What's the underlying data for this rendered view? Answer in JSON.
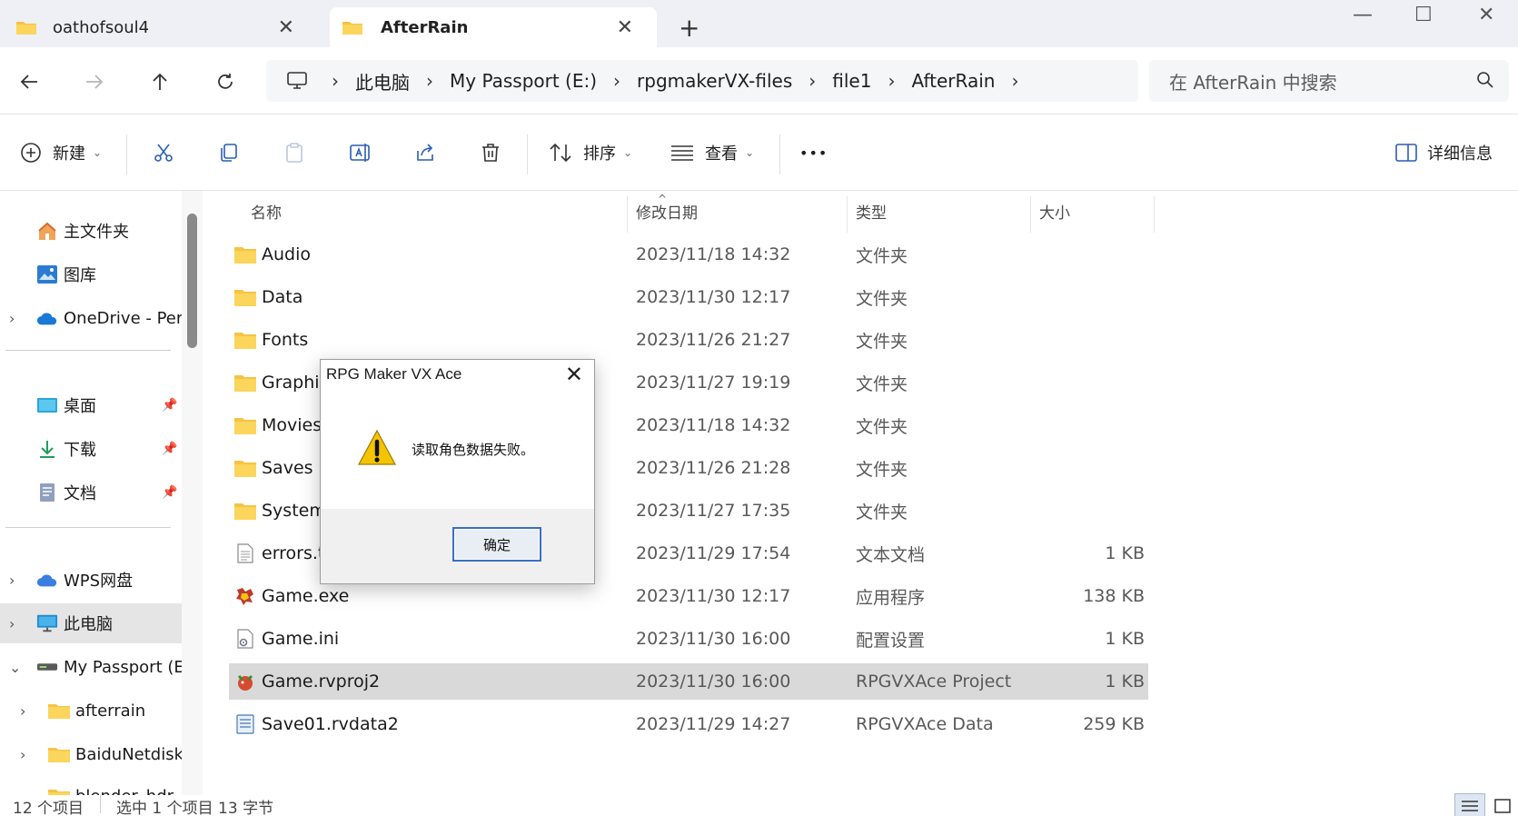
{
  "tabs": [
    {
      "label": "oathofsoul4",
      "active": false
    },
    {
      "label": "AfterRain",
      "active": true
    }
  ],
  "new_tab_symbol": "+",
  "window_controls": {
    "minimize": "—",
    "maximize": "☐",
    "close": "✕"
  },
  "breadcrumb": {
    "items": [
      "此电脑",
      "My Passport (E:)",
      "rpgmakerVX-files",
      "file1",
      "AfterRain"
    ],
    "separator": "›"
  },
  "search": {
    "placeholder": "在 AfterRain 中搜索"
  },
  "commands": {
    "new_label": "新建",
    "sort_label": "排序",
    "view_label": "查看",
    "more_label": "•••",
    "details_label": "详细信息"
  },
  "sidebar": {
    "items": [
      {
        "label": "主文件夹",
        "icon": "home-icon"
      },
      {
        "label": "图库",
        "icon": "gallery-icon"
      },
      {
        "label": "OneDrive - Per",
        "icon": "cloud-icon"
      },
      {
        "label": "桌面",
        "icon": "desktop-icon"
      },
      {
        "label": "下载",
        "icon": "download-icon"
      },
      {
        "label": "文档",
        "icon": "document-icon"
      },
      {
        "label": "WPS网盘",
        "icon": "cloud-icon"
      },
      {
        "label": "此电脑",
        "icon": "computer-icon"
      },
      {
        "label": "My Passport (E",
        "icon": "drive-icon"
      },
      {
        "label": "afterrain",
        "icon": "folder-icon"
      },
      {
        "label": "BaiduNetdisk",
        "icon": "folder-icon"
      },
      {
        "label": "blender_hdr",
        "icon": "folder-icon"
      }
    ]
  },
  "columns": {
    "name": "名称",
    "date": "修改日期",
    "type": "类型",
    "size": "大小"
  },
  "files": [
    {
      "name": "Audio",
      "date": "2023/11/18 14:32",
      "type": "文件夹",
      "size": "",
      "icon": "folder"
    },
    {
      "name": "Data",
      "date": "2023/11/30 12:17",
      "type": "文件夹",
      "size": "",
      "icon": "folder"
    },
    {
      "name": "Fonts",
      "date": "2023/11/26 21:27",
      "type": "文件夹",
      "size": "",
      "icon": "folder"
    },
    {
      "name": "Graphic",
      "date": "2023/11/27 19:19",
      "type": "文件夹",
      "size": "",
      "icon": "folder"
    },
    {
      "name": "Movies",
      "date": "2023/11/18 14:32",
      "type": "文件夹",
      "size": "",
      "icon": "folder"
    },
    {
      "name": "Saves",
      "date": "2023/11/26 21:28",
      "type": "文件夹",
      "size": "",
      "icon": "folder"
    },
    {
      "name": "System",
      "date": "2023/11/27 17:35",
      "type": "文件夹",
      "size": "",
      "icon": "folder"
    },
    {
      "name": "errors.tx",
      "date": "2023/11/29 17:54",
      "type": "文本文档",
      "size": "1 KB",
      "icon": "text"
    },
    {
      "name": "Game.exe",
      "date": "2023/11/30 12:17",
      "type": "应用程序",
      "size": "138 KB",
      "icon": "exe"
    },
    {
      "name": "Game.ini",
      "date": "2023/11/30 16:00",
      "type": "配置设置",
      "size": "1 KB",
      "icon": "ini"
    },
    {
      "name": "Game.rvproj2",
      "date": "2023/11/30 16:00",
      "type": "RPGVXAce Project",
      "size": "1 KB",
      "icon": "rvproj",
      "selected": true
    },
    {
      "name": "Save01.rvdata2",
      "date": "2023/11/29 14:27",
      "type": "RPGVXAce Data",
      "size": "259 KB",
      "icon": "rvdata"
    }
  ],
  "status": {
    "count": "12 个项目",
    "selection": "选中 1 个项目  13 字节"
  },
  "dialog": {
    "title": "RPG Maker VX Ace",
    "message": "读取角色数据失败。",
    "ok_label": "确定",
    "close_symbol": "✕"
  },
  "colors": {
    "folder": "#f6c343",
    "accent": "#3a6fc4",
    "selected_row": "#d9d9d9",
    "warning": "#f5c400"
  }
}
